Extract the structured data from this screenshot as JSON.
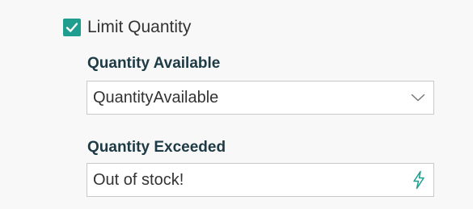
{
  "limit_checkbox": {
    "label": "Limit Quantity",
    "checked": true,
    "color": "#1f9e8f"
  },
  "quantity_available": {
    "label": "Quantity Available",
    "value": "QuantityAvailable",
    "icon": "chevron-down-icon"
  },
  "quantity_exceeded": {
    "label": "Quantity Exceeded",
    "value": "Out of stock!",
    "icon": "lightning-icon",
    "icon_color": "#1f9e8f"
  }
}
